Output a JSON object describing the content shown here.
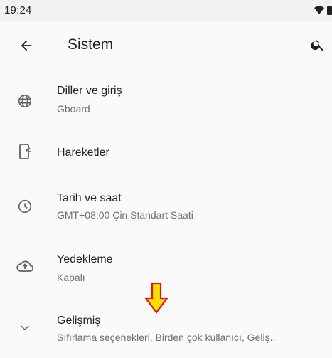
{
  "status_bar": {
    "time": "19:24",
    "icons": [
      "wifi-icon",
      "battery-icon"
    ]
  },
  "app_bar": {
    "title": "Sistem",
    "back_icon": "arrow-left-icon",
    "search_icon": "search-icon"
  },
  "items": [
    {
      "title": "Diller ve giriş",
      "subtitle": "Gboard",
      "icon": "globe-icon"
    },
    {
      "title": "Hareketler",
      "subtitle": "",
      "icon": "phone-gesture-icon"
    },
    {
      "title": "Tarih ve saat",
      "subtitle": "GMT+08:00 Çin Standart Saati",
      "icon": "clock-icon"
    },
    {
      "title": "Yedekleme",
      "subtitle": "Kapalı",
      "icon": "cloud-upload-icon"
    },
    {
      "title": "Gelişmiş",
      "subtitle": "Sıfırlama seçenekleri, Birden çok kullanıcı, Geliş..",
      "icon": "chevron-down-icon"
    }
  ],
  "annotation": {
    "arrow_color": "#ffdd00",
    "arrow_outline": "#e8120c"
  }
}
